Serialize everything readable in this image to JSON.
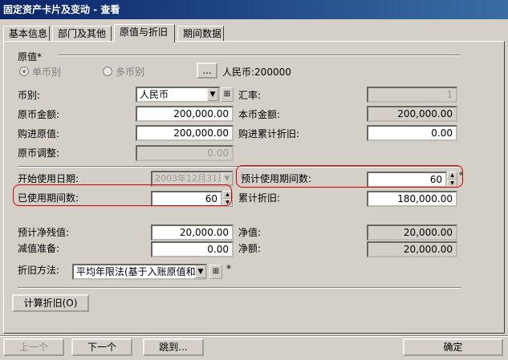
{
  "window": {
    "title": "固定资产卡片及变动 - 查看"
  },
  "tabs": [
    {
      "label": "基本信息"
    },
    {
      "label": "部门及其他"
    },
    {
      "label": "原值与折旧"
    },
    {
      "label": "期间数据"
    }
  ],
  "original_value": {
    "section_label": "原值*",
    "radio_single": "单币别",
    "radio_multi": "多币别",
    "ellipsis_button": "...",
    "summary": "人民币:200000"
  },
  "fields": {
    "currency_label": "币别:",
    "currency_value": "人民币",
    "exchange_rate_label": "汇率:",
    "exchange_rate_value": "1",
    "orig_amount_label": "原币金额:",
    "orig_amount_value": "200,000.00",
    "local_amount_label": "本币金额:",
    "local_amount_value": "200,000.00",
    "purchase_orig_label": "购进原值:",
    "purchase_orig_value": "200,000.00",
    "purchase_dep_label": "购进累计折旧:",
    "purchase_dep_value": "0.00",
    "orig_adjust_label": "原币调整:",
    "orig_adjust_value": "0.00",
    "start_date_label": "开始使用日期:",
    "start_date_value": "2003年12月31日",
    "est_periods_label": "预计使用期间数:",
    "est_periods_value": "60",
    "used_periods_label": "已使用期间数:",
    "used_periods_value": "60",
    "accum_dep_label": "累计折旧:",
    "accum_dep_value": "180,000.00",
    "residual_label": "预计净残值:",
    "residual_value": "20,000.00",
    "net_value_label": "净值:",
    "net_value_value": "20,000.00",
    "impairment_label": "减值准备:",
    "impairment_value": "0.00",
    "net_amount_label": "净额:",
    "net_amount_value": "20,000.00",
    "dep_method_label": "折旧方法:",
    "dep_method_value": "平均年限法(基于入账原值和",
    "required_mark": "*"
  },
  "buttons": {
    "calc_dep": "计算折旧(O)",
    "prev": "上一个",
    "next": "下一个",
    "jump": "跳到...",
    "ok": "确定"
  },
  "colors": {
    "annotation_red": "#d00000",
    "title_bar": "#0a246a"
  }
}
